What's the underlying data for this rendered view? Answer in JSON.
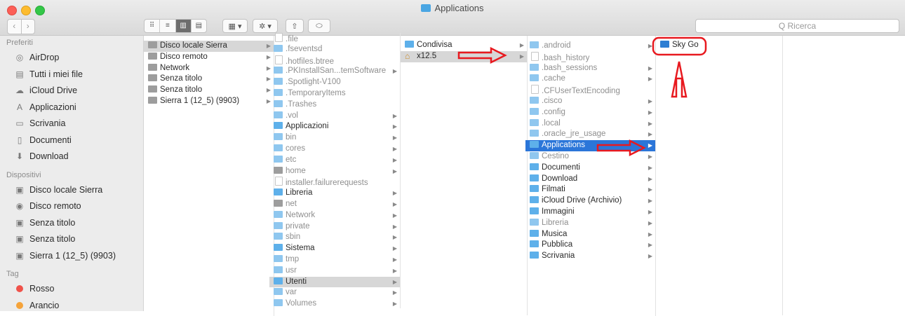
{
  "window": {
    "title": "Applications"
  },
  "search": {
    "placeholder": "Q Ricerca"
  },
  "toolbar": {
    "view_icons": [
      "⠿",
      "≡",
      "▥",
      "▤"
    ],
    "group_icon": "▦ ▾",
    "action_icon": "✲ ▾",
    "share_icon": "⇧",
    "tag_icon": "⬭"
  },
  "nav": {
    "back": "‹",
    "forward": "›"
  },
  "sidebar": {
    "favorites_header": "Preferiti",
    "favorites": [
      {
        "label": "AirDrop",
        "icon": "airdrop-icon",
        "glyph": "◎"
      },
      {
        "label": "Tutti i miei file",
        "icon": "all-files-icon",
        "glyph": "▤"
      },
      {
        "label": "iCloud Drive",
        "icon": "cloud-icon",
        "glyph": "☁"
      },
      {
        "label": "Applicazioni",
        "icon": "applications-icon",
        "glyph": "A"
      },
      {
        "label": "Scrivania",
        "icon": "desktop-icon",
        "glyph": "▭"
      },
      {
        "label": "Documenti",
        "icon": "documents-icon",
        "glyph": "▯"
      },
      {
        "label": "Download",
        "icon": "download-icon",
        "glyph": "⬇"
      }
    ],
    "devices_header": "Dispositivi",
    "devices": [
      {
        "label": "Disco locale Sierra",
        "icon": "disk-icon",
        "glyph": "▣"
      },
      {
        "label": "Disco remoto",
        "icon": "remote-disk-icon",
        "glyph": "◉"
      },
      {
        "label": "Senza titolo",
        "icon": "disk-icon",
        "glyph": "▣"
      },
      {
        "label": "Senza titolo",
        "icon": "disk-icon",
        "glyph": "▣"
      },
      {
        "label": "Sierra 1 (12_5) (9903)",
        "icon": "disk-icon",
        "glyph": "▣"
      }
    ],
    "tags_header": "Tag",
    "tags": [
      {
        "label": "Rosso",
        "color": "#f0524a"
      },
      {
        "label": "Arancio",
        "color": "#f5a33a"
      }
    ]
  },
  "columns": [
    {
      "rows": [
        {
          "label": "Disco locale Sierra",
          "icon": "disk",
          "chevron": true,
          "state": "sel-gray"
        },
        {
          "label": "Disco remoto",
          "icon": "disk",
          "chevron": true
        },
        {
          "label": "Network",
          "icon": "disk",
          "chevron": true
        },
        {
          "label": "Senza titolo",
          "icon": "disk",
          "chevron": true
        },
        {
          "label": "Senza titolo",
          "icon": "disk",
          "chevron": true
        },
        {
          "label": "Sierra 1 (12_5) (9903)",
          "icon": "disk",
          "chevron": true
        }
      ]
    },
    {
      "rows": [
        {
          "label": ".file",
          "icon": "file",
          "gray": true
        },
        {
          "label": ".fseventsd",
          "icon": "folder",
          "gray": true
        },
        {
          "label": ".hotfiles.btree",
          "icon": "file",
          "gray": true
        },
        {
          "label": ".PKInstallSan...temSoftware",
          "icon": "folder",
          "gray": true,
          "chevron": true
        },
        {
          "label": ".Spotlight-V100",
          "icon": "folder",
          "gray": true
        },
        {
          "label": ".TemporaryItems",
          "icon": "folder",
          "gray": true
        },
        {
          "label": ".Trashes",
          "icon": "folder",
          "gray": true
        },
        {
          "label": ".vol",
          "icon": "folder",
          "gray": true,
          "chevron": true
        },
        {
          "label": "Applicazioni",
          "icon": "folder-dk",
          "chevron": true
        },
        {
          "label": "bin",
          "icon": "folder",
          "gray": true,
          "chevron": true
        },
        {
          "label": "cores",
          "icon": "folder",
          "gray": true,
          "chevron": true
        },
        {
          "label": "etc",
          "icon": "folder",
          "gray": true,
          "chevron": true
        },
        {
          "label": "home",
          "icon": "disk",
          "gray": true,
          "chevron": true
        },
        {
          "label": "installer.failurerequests",
          "icon": "file",
          "gray": true
        },
        {
          "label": "Libreria",
          "icon": "folder-dk",
          "chevron": true
        },
        {
          "label": "net",
          "icon": "disk",
          "gray": true,
          "chevron": true
        },
        {
          "label": "Network",
          "icon": "folder",
          "gray": true,
          "chevron": true
        },
        {
          "label": "private",
          "icon": "folder",
          "gray": true,
          "chevron": true
        },
        {
          "label": "sbin",
          "icon": "folder",
          "gray": true,
          "chevron": true
        },
        {
          "label": "Sistema",
          "icon": "folder-dk",
          "chevron": true
        },
        {
          "label": "tmp",
          "icon": "folder",
          "gray": true,
          "chevron": true
        },
        {
          "label": "usr",
          "icon": "folder",
          "gray": true,
          "chevron": true
        },
        {
          "label": "Utenti",
          "icon": "folder-dk",
          "chevron": true,
          "state": "sel-gray"
        },
        {
          "label": "var",
          "icon": "folder",
          "gray": true,
          "chevron": true
        },
        {
          "label": "Volumes",
          "icon": "folder",
          "gray": true,
          "chevron": true
        }
      ]
    },
    {
      "rows": [
        {
          "label": "Condivisa",
          "icon": "folder-dk",
          "chevron": true
        },
        {
          "label": "x12.5",
          "icon": "home",
          "chevron": true,
          "state": "sel-gray"
        }
      ]
    },
    {
      "rows": [
        {
          "label": ".android",
          "icon": "folder",
          "gray": true,
          "chevron": true
        },
        {
          "label": ".bash_history",
          "icon": "file",
          "gray": true
        },
        {
          "label": ".bash_sessions",
          "icon": "folder",
          "gray": true,
          "chevron": true
        },
        {
          "label": ".cache",
          "icon": "folder",
          "gray": true,
          "chevron": true
        },
        {
          "label": ".CFUserTextEncoding",
          "icon": "file",
          "gray": true
        },
        {
          "label": ".cisco",
          "icon": "folder",
          "gray": true,
          "chevron": true
        },
        {
          "label": ".config",
          "icon": "folder",
          "gray": true,
          "chevron": true
        },
        {
          "label": ".local",
          "icon": "folder",
          "gray": true,
          "chevron": true
        },
        {
          "label": ".oracle_jre_usage",
          "icon": "folder",
          "gray": true,
          "chevron": true
        },
        {
          "label": "Applications",
          "icon": "folder-dk",
          "chevron": true,
          "state": "sel-blue"
        },
        {
          "label": "Cestino",
          "icon": "folder",
          "gray": true,
          "chevron": true
        },
        {
          "label": "Documenti",
          "icon": "folder-dk",
          "chevron": true
        },
        {
          "label": "Download",
          "icon": "folder-dk",
          "chevron": true
        },
        {
          "label": "Filmati",
          "icon": "folder-dk",
          "chevron": true
        },
        {
          "label": "iCloud Drive (Archivio)",
          "icon": "folder-dk",
          "chevron": true
        },
        {
          "label": "Immagini",
          "icon": "folder-dk",
          "chevron": true
        },
        {
          "label": "Libreria",
          "icon": "folder",
          "gray": true,
          "chevron": true
        },
        {
          "label": "Musica",
          "icon": "folder-dk",
          "chevron": true
        },
        {
          "label": "Pubblica",
          "icon": "folder-dk",
          "chevron": true
        },
        {
          "label": "Scrivania",
          "icon": "folder-dk",
          "chevron": true
        }
      ]
    },
    {
      "rows": [
        {
          "label": "Sky Go",
          "icon": "app"
        }
      ]
    }
  ],
  "annotation_color": "#e8191f"
}
